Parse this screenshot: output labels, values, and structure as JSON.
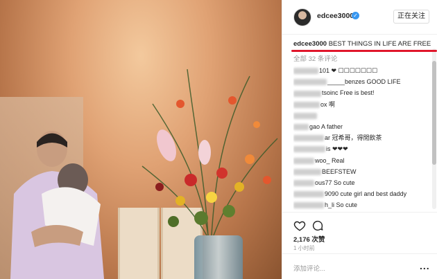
{
  "post": {
    "username": "edcee3000",
    "follow_label": "正在关注",
    "caption_user": "edcee3000",
    "caption_text": "BEST THINGS IN LIFE ARE FREE",
    "all_comments_label": "全部 32 条评论",
    "likes_label": "2,176 次赞",
    "time_label": "1 小时前",
    "add_comment_placeholder": "添加评论...",
    "more_label": "..."
  },
  "comments": [
    {
      "visible_text": "101 ❤ ☐☐☐☐☐☐☐"
    },
    {
      "visible_text": "_____benzes GOOD LIFE"
    },
    {
      "visible_text": "tsoinc Free is best!"
    },
    {
      "visible_text": "ox 啊"
    },
    {
      "visible_text": ""
    },
    {
      "visible_text": "gao A father"
    },
    {
      "visible_text": "ar 冠希哥，得閒飲茶"
    },
    {
      "visible_text": "is ❤❤❤"
    },
    {
      "visible_text": "woo_ Real"
    },
    {
      "visible_text": "BEEFSTEW"
    },
    {
      "visible_text": "ous77 So cute"
    },
    {
      "visible_text": "9090 cute girl and best daddy"
    },
    {
      "visible_text": "h_li So cute"
    }
  ],
  "colors": {
    "accent_red": "#e0162b",
    "verified_blue": "#3897f0"
  }
}
